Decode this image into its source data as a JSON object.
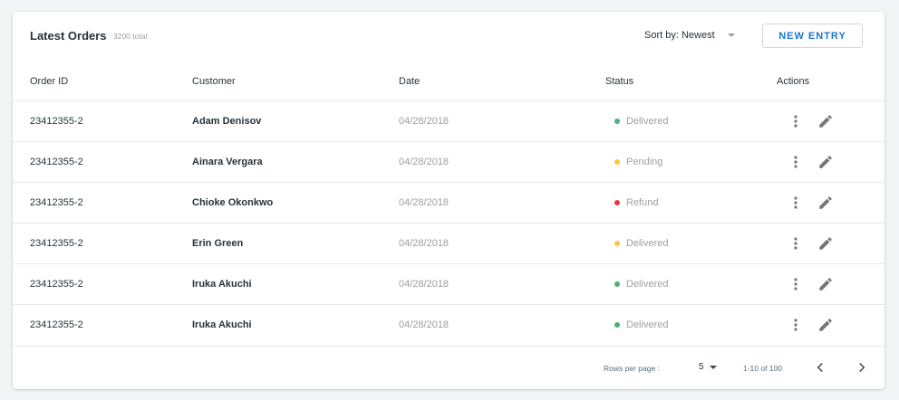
{
  "header": {
    "title": "Latest Orders",
    "total": "3200 total",
    "sort_label": "Sort by: Newest",
    "new_entry_label": "NEW ENTRY"
  },
  "columns": [
    "Order ID",
    "Customer",
    "Date",
    "Status",
    "Actions"
  ],
  "rows": [
    {
      "id": "23412355-2",
      "customer": "Adam Denisov",
      "date": "04/28/2018",
      "status": "Delivered",
      "status_color": "#4caf7d"
    },
    {
      "id": "23412355-2",
      "customer": "Ainara Vergara",
      "date": "04/28/2018",
      "status": "Pending",
      "status_color": "#f5c842"
    },
    {
      "id": "23412355-2",
      "customer": "Chioke Okonkwo",
      "date": "04/28/2018",
      "status": "Refund",
      "status_color": "#e53935"
    },
    {
      "id": "23412355-2",
      "customer": "Erin Green",
      "date": "04/28/2018",
      "status": "Delivered",
      "status_color": "#f5c842"
    },
    {
      "id": "23412355-2",
      "customer": "Iruka Akuchi",
      "date": "04/28/2018",
      "status": "Delivered",
      "status_color": "#4caf7d"
    },
    {
      "id": "23412355-2",
      "customer": "Iruka Akuchi",
      "date": "04/28/2018",
      "status": "Delivered",
      "status_color": "#4caf7d"
    }
  ],
  "row_actions": [
    "more-vert-icon",
    "edit-icon"
  ],
  "footer": {
    "rows_per_page_label": "Rows per page :",
    "rows_per_page_value": "5",
    "range": "1-10 of 100"
  },
  "colors": {
    "accent": "#1976d2",
    "delivered": "#4caf7d",
    "pending": "#f5c842",
    "refund": "#e53935"
  }
}
